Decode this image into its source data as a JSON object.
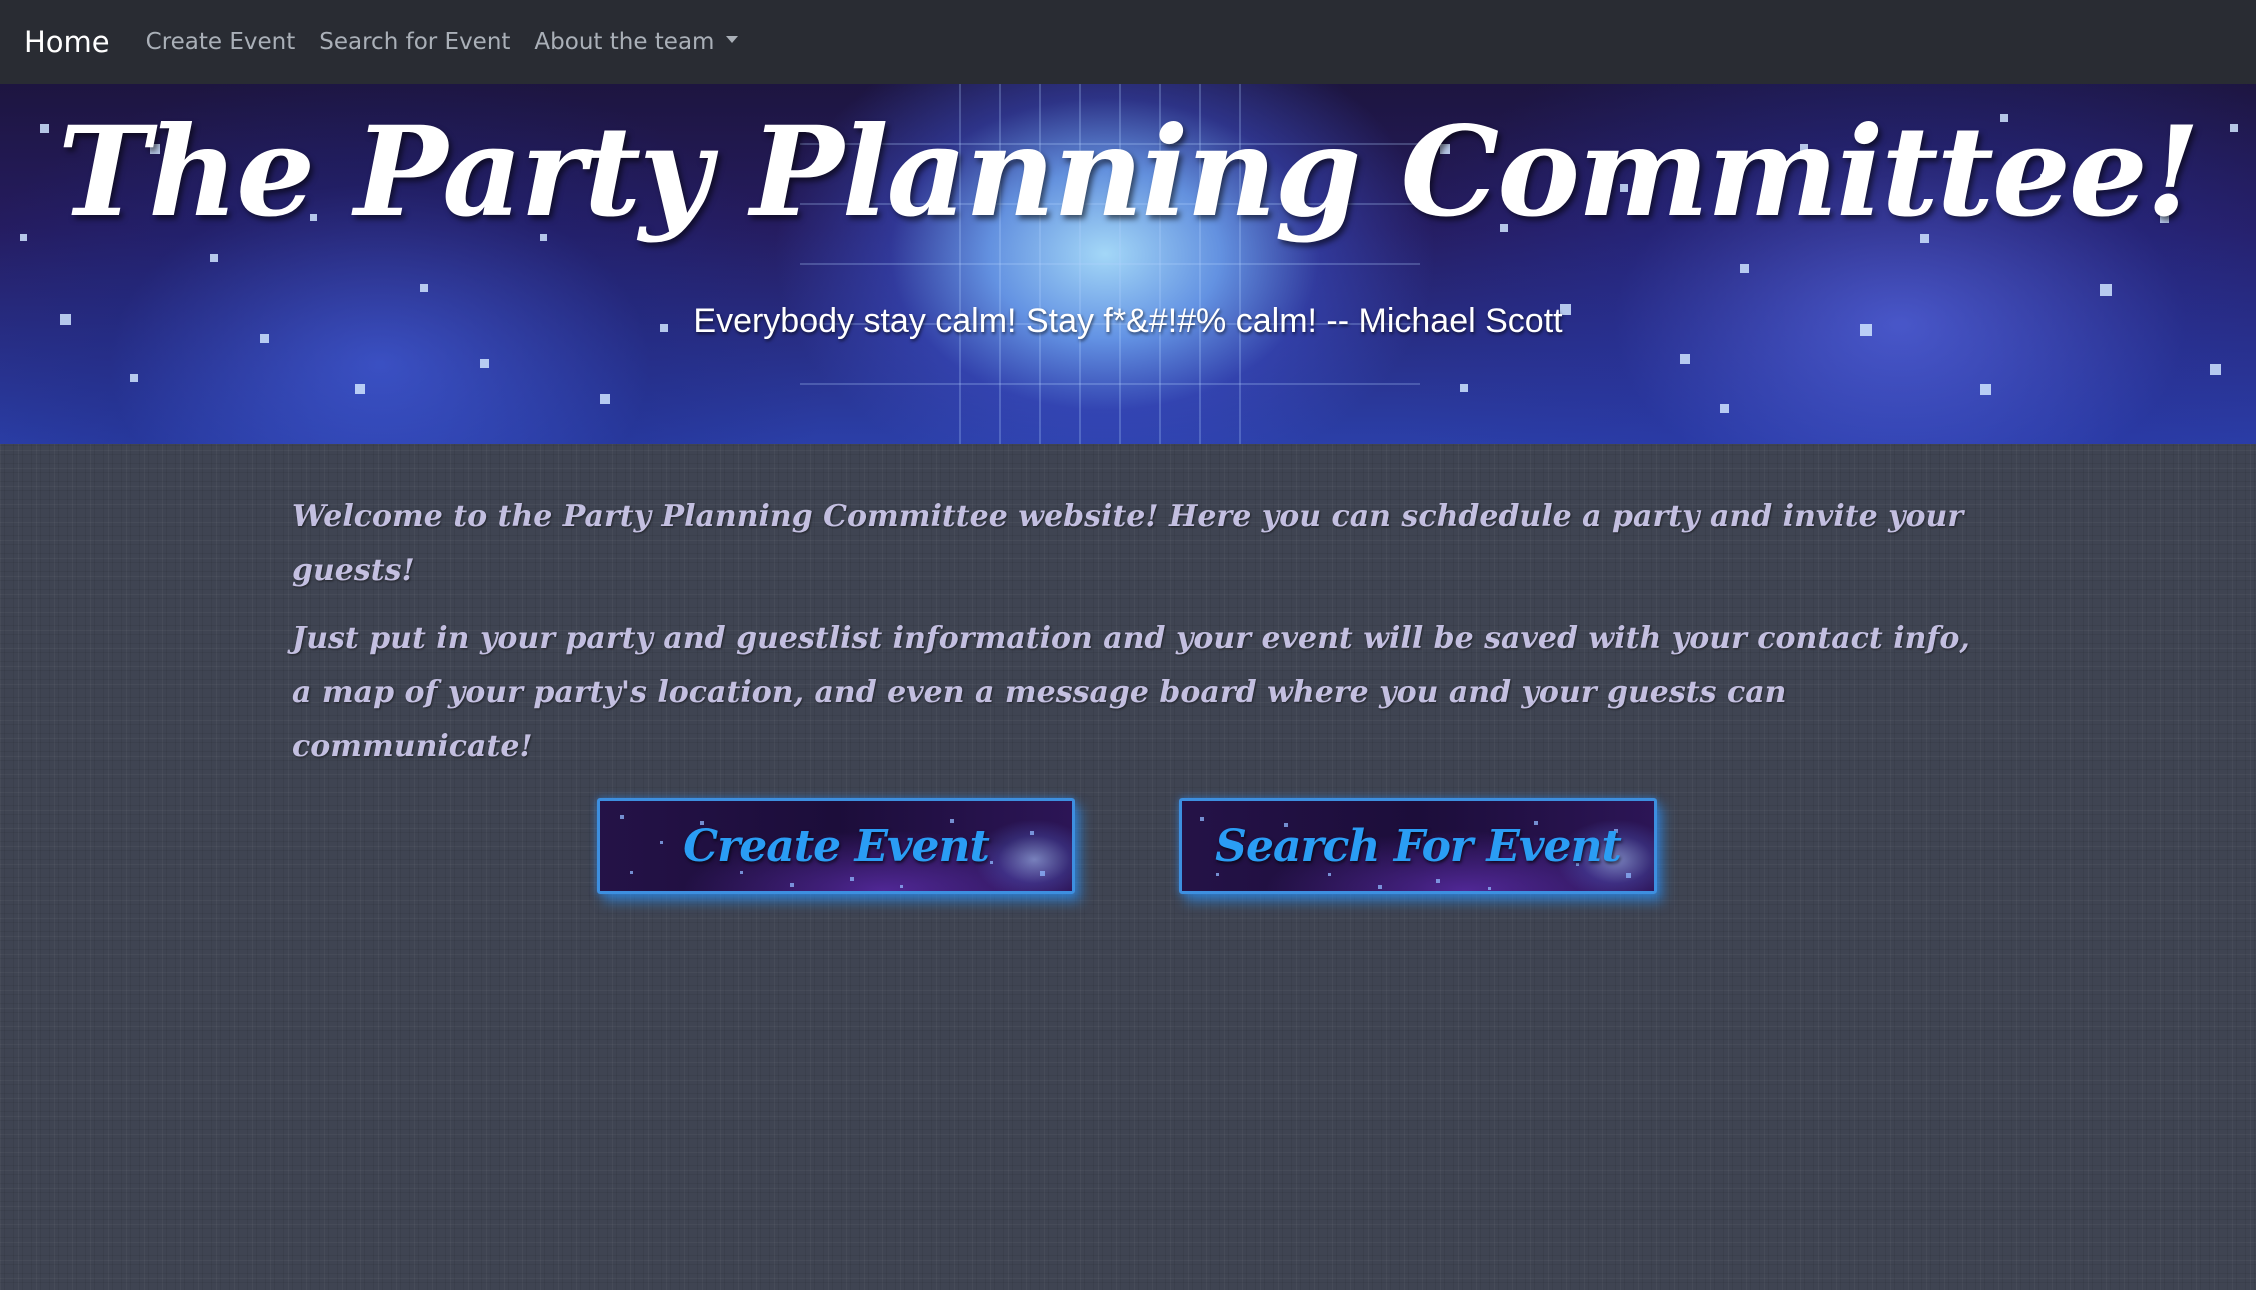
{
  "navbar": {
    "brand": "Home",
    "links": [
      "Create Event",
      "Search for Event"
    ],
    "dropdown": "About the team"
  },
  "hero": {
    "title": "The Party Planning Committee!",
    "quote": "Everybody stay calm! Stay f*&#!#% calm! -- Michael Scott"
  },
  "intro": {
    "paragraph1": "Welcome to the Party Planning Committee website! Here you can schdedule a party and invite your guests!",
    "paragraph2": "Just put in your party and guestlist information and your event will be saved with your contact info, a map of your party's location, and even a message board where you and your guests can communicate!"
  },
  "buttons": {
    "create": "Create Event",
    "search": "Search For Event"
  },
  "colors": {
    "navbar_bg": "#292c33",
    "page_bg": "#3f4452",
    "button_text": "#2a9df4",
    "intro_text": "#c3bfe0"
  }
}
